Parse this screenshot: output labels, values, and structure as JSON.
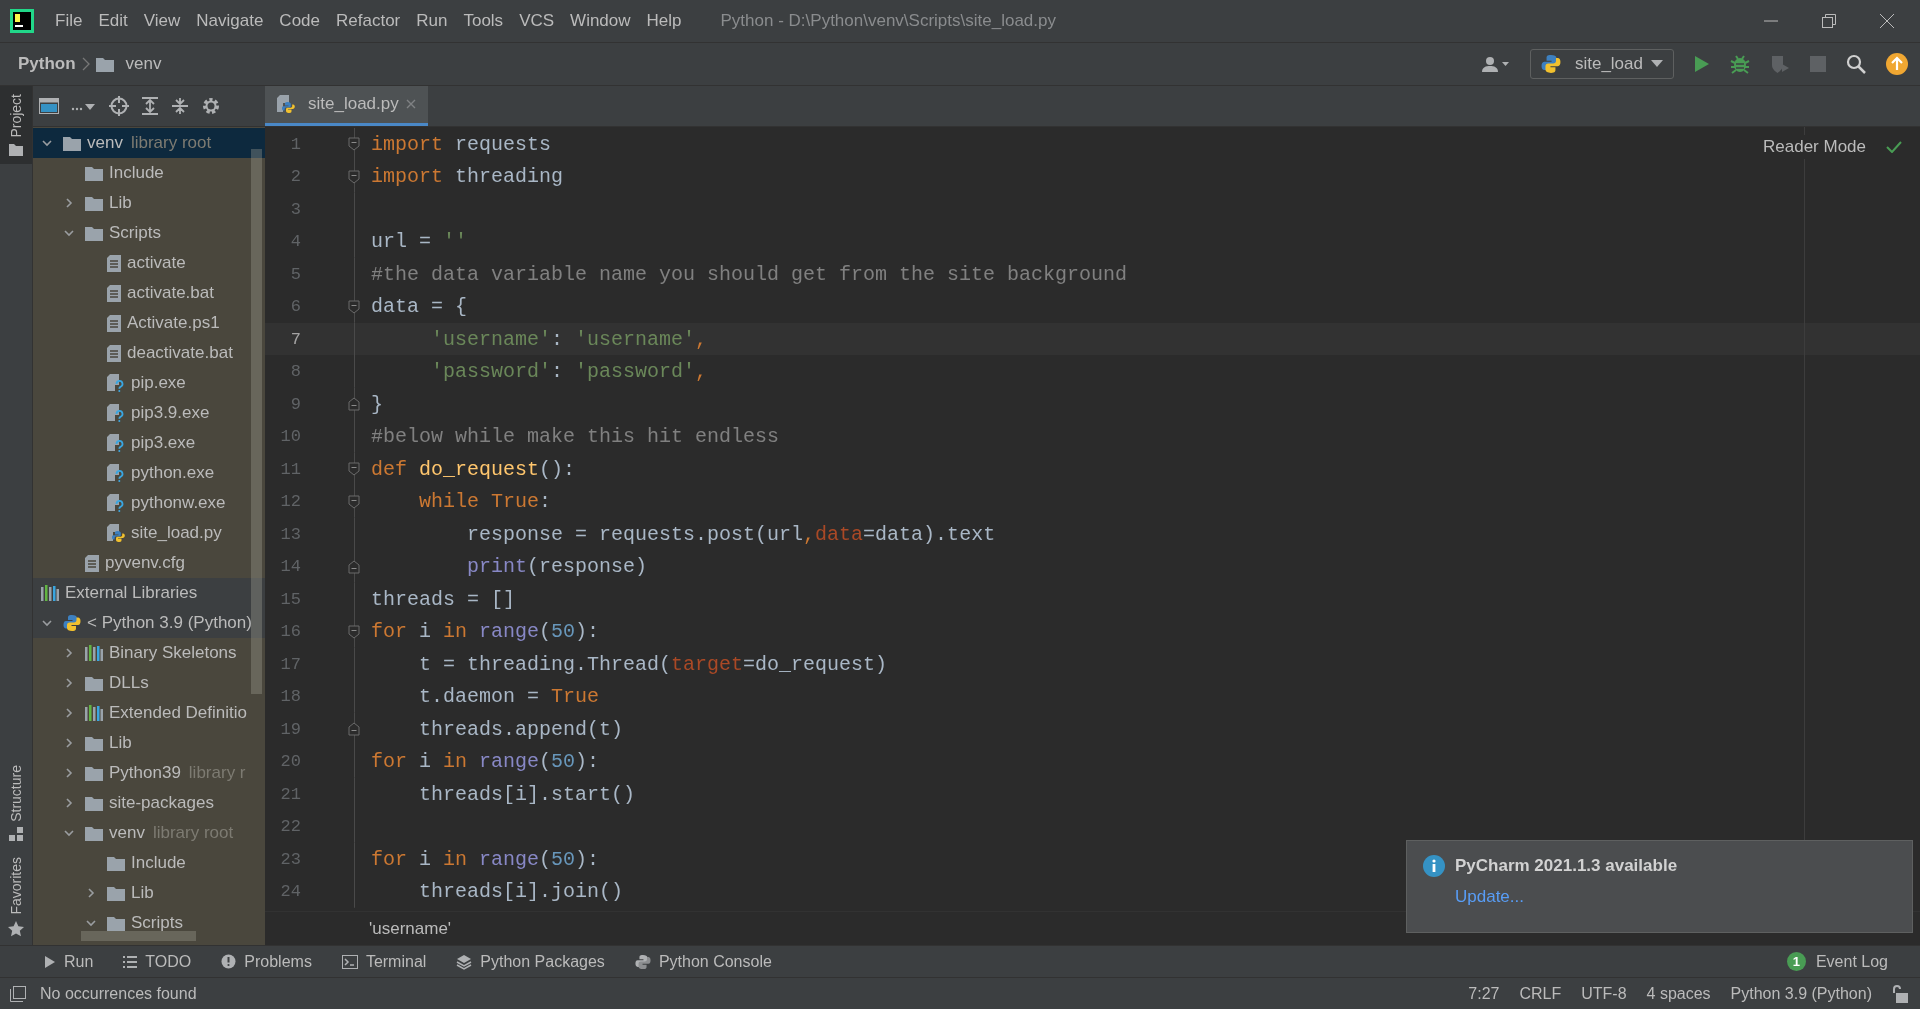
{
  "title_bar": {
    "menu": [
      "File",
      "Edit",
      "View",
      "Navigate",
      "Code",
      "Refactor",
      "Run",
      "Tools",
      "VCS",
      "Window",
      "Help"
    ],
    "title": "Python - D:\\Python\\venv\\Scripts\\site_load.py"
  },
  "navigation_bar": {
    "project": "Python",
    "folder": "venv",
    "run_config": "site_load"
  },
  "side_strip": {
    "top": [
      {
        "label": "Project",
        "kind": "folder",
        "selected": true
      }
    ],
    "bottom": [
      {
        "label": "Structure",
        "kind": "structure",
        "selected": false
      },
      {
        "label": "Favorites",
        "kind": "star",
        "selected": false
      }
    ]
  },
  "project_tree": [
    {
      "label": "venv",
      "suffix": "library root",
      "kind": "folder",
      "expanded": true,
      "selected": true,
      "children": [
        {
          "label": "Include",
          "kind": "folder",
          "selected": false
        },
        {
          "label": "Lib",
          "kind": "folder",
          "expanded": false,
          "selected": false
        },
        {
          "label": "Scripts",
          "kind": "folder",
          "expanded": true,
          "selected": false,
          "children": [
            {
              "label": "activate",
              "kind": "text",
              "selected": false
            },
            {
              "label": "activate.bat",
              "kind": "text",
              "selected": false
            },
            {
              "label": "Activate.ps1",
              "kind": "text",
              "selected": false
            },
            {
              "label": "deactivate.bat",
              "kind": "text",
              "selected": false
            },
            {
              "label": "pip.exe",
              "kind": "unknown",
              "selected": false
            },
            {
              "label": "pip3.9.exe",
              "kind": "unknown",
              "selected": false
            },
            {
              "label": "pip3.exe",
              "kind": "unknown",
              "selected": false
            },
            {
              "label": "python.exe",
              "kind": "unknown",
              "selected": false
            },
            {
              "label": "pythonw.exe",
              "kind": "unknown",
              "selected": false
            },
            {
              "label": "site_load.py",
              "kind": "python",
              "selected": false
            }
          ]
        },
        {
          "label": "pyvenv.cfg",
          "kind": "text",
          "selected": false
        }
      ]
    },
    {
      "label": "External Libraries",
      "kind": "libraries",
      "selected": false,
      "children": [
        {
          "label": "< Python 3.9 (Python)",
          "kind": "sdk",
          "expanded": true,
          "selected": false,
          "children": [
            {
              "label": "Binary Skeletons",
              "kind": "library",
              "expanded": false,
              "selected": false
            },
            {
              "label": "DLLs",
              "kind": "folder",
              "expanded": false,
              "selected": false
            },
            {
              "label": "Extended Definitio",
              "kind": "library",
              "expanded": false,
              "selected": false
            },
            {
              "label": "Lib",
              "kind": "folder",
              "expanded": false,
              "selected": false
            },
            {
              "label": "Python39",
              "suffix": "library r",
              "kind": "folder",
              "expanded": false,
              "selected": false
            },
            {
              "label": "site-packages",
              "kind": "folder",
              "expanded": false,
              "selected": false
            },
            {
              "label": "venv",
              "suffix": "library root",
              "kind": "folder",
              "expanded": true,
              "selected": false,
              "children": [
                {
                  "label": "Include",
                  "kind": "folder",
                  "selected": false
                },
                {
                  "label": "Lib",
                  "kind": "folder",
                  "expanded": false,
                  "selected": false
                },
                {
                  "label": "Scripts",
                  "kind": "folder",
                  "expanded": true,
                  "selected": false
                }
              ]
            }
          ]
        }
      ]
    }
  ],
  "editor_tabs": [
    {
      "label": "site_load.py",
      "selected": true
    }
  ],
  "reader_mode": "Reader Mode",
  "code_lines": [
    {
      "number": "1",
      "kind": "fold-start",
      "current": false,
      "tokens": [
        {
          "kind": "keyword",
          "text": "import"
        },
        {
          "kind": "plain",
          "text": " requests"
        }
      ]
    },
    {
      "number": "2",
      "kind": "fold-start",
      "current": false,
      "tokens": [
        {
          "kind": "keyword",
          "text": "import"
        },
        {
          "kind": "plain",
          "text": " threading"
        }
      ]
    },
    {
      "number": "3",
      "current": false
    },
    {
      "number": "4",
      "current": false,
      "tokens": [
        {
          "kind": "plain",
          "text": "url = "
        },
        {
          "kind": "string",
          "text": "''"
        }
      ]
    },
    {
      "number": "5",
      "current": false,
      "tokens": [
        {
          "kind": "comment",
          "text": "#the data variable name you should get from the site background"
        }
      ]
    },
    {
      "number": "6",
      "kind": "fold-start",
      "current": false,
      "tokens": [
        {
          "kind": "plain",
          "text": "data = {"
        }
      ]
    },
    {
      "number": "7",
      "current": true,
      "tokens": [
        {
          "kind": "string",
          "text": "     'username'"
        },
        {
          "kind": "plain",
          "text": ": "
        },
        {
          "kind": "string",
          "text": "'username'"
        },
        {
          "kind": "keyword",
          "text": ","
        }
      ]
    },
    {
      "number": "8",
      "current": false,
      "tokens": [
        {
          "kind": "string",
          "text": "     'password'"
        },
        {
          "kind": "plain",
          "text": ": "
        },
        {
          "kind": "string",
          "text": "'password'"
        },
        {
          "kind": "keyword",
          "text": ","
        }
      ]
    },
    {
      "number": "9",
      "kind": "fold-end",
      "current": false,
      "tokens": [
        {
          "kind": "plain",
          "text": "}"
        }
      ]
    },
    {
      "number": "10",
      "current": false,
      "tokens": [
        {
          "kind": "comment",
          "text": "#below while make this hit endless"
        }
      ]
    },
    {
      "number": "11",
      "kind": "fold-start",
      "current": false,
      "tokens": [
        {
          "kind": "keyword",
          "text": "def"
        },
        {
          "kind": "function",
          "text": " do_request"
        },
        {
          "kind": "plain",
          "text": "():"
        }
      ]
    },
    {
      "number": "12",
      "kind": "fold-start",
      "current": false,
      "tokens": [
        {
          "kind": "keyword",
          "text": "    while"
        },
        {
          "kind": "keyword",
          "text": " True"
        },
        {
          "kind": "plain",
          "text": ":"
        }
      ]
    },
    {
      "number": "13",
      "current": false,
      "tokens": [
        {
          "kind": "plain",
          "text": "        response = requests.post(url"
        },
        {
          "kind": "keyword",
          "text": ","
        },
        {
          "kind": "parameter",
          "text": "data"
        },
        {
          "kind": "plain",
          "text": "=data).text"
        }
      ]
    },
    {
      "number": "14",
      "kind": "fold-end",
      "current": false,
      "tokens": [
        {
          "kind": "builtin",
          "text": "        print"
        },
        {
          "kind": "plain",
          "text": "(response)"
        }
      ]
    },
    {
      "number": "15",
      "current": false,
      "tokens": [
        {
          "kind": "plain",
          "text": "threads = []"
        }
      ]
    },
    {
      "number": "16",
      "kind": "fold-start",
      "current": false,
      "tokens": [
        {
          "kind": "keyword",
          "text": "for"
        },
        {
          "kind": "plain",
          "text": " i "
        },
        {
          "kind": "keyword",
          "text": "in"
        },
        {
          "kind": "builtin",
          "text": " range"
        },
        {
          "kind": "plain",
          "text": "("
        },
        {
          "kind": "number",
          "text": "50"
        },
        {
          "kind": "plain",
          "text": "):"
        }
      ]
    },
    {
      "number": "17",
      "current": false,
      "tokens": [
        {
          "kind": "plain",
          "text": "    t = threading.Thread("
        },
        {
          "kind": "parameter",
          "text": "target"
        },
        {
          "kind": "plain",
          "text": "=do_request)"
        }
      ]
    },
    {
      "number": "18",
      "current": false,
      "tokens": [
        {
          "kind": "plain",
          "text": "    t.daemon = "
        },
        {
          "kind": "keyword",
          "text": "True"
        }
      ]
    },
    {
      "number": "19",
      "kind": "fold-end",
      "current": false,
      "tokens": [
        {
          "kind": "plain",
          "text": "    threads.append(t)"
        }
      ]
    },
    {
      "number": "20",
      "current": false,
      "tokens": [
        {
          "kind": "keyword",
          "text": "for"
        },
        {
          "kind": "plain",
          "text": " i "
        },
        {
          "kind": "keyword",
          "text": "in"
        },
        {
          "kind": "builtin",
          "text": " range"
        },
        {
          "kind": "plain",
          "text": "("
        },
        {
          "kind": "number",
          "text": "50"
        },
        {
          "kind": "plain",
          "text": "):"
        }
      ]
    },
    {
      "number": "21",
      "current": false,
      "tokens": [
        {
          "kind": "plain",
          "text": "    threads[i].start()"
        }
      ]
    },
    {
      "number": "22",
      "current": false
    },
    {
      "number": "23",
      "current": false,
      "tokens": [
        {
          "kind": "keyword",
          "text": "for"
        },
        {
          "kind": "plain",
          "text": " i "
        },
        {
          "kind": "keyword",
          "text": "in"
        },
        {
          "kind": "builtin",
          "text": " range"
        },
        {
          "kind": "plain",
          "text": "("
        },
        {
          "kind": "number",
          "text": "50"
        },
        {
          "kind": "plain",
          "text": "):"
        }
      ]
    },
    {
      "number": "24",
      "current": false,
      "tokens": [
        {
          "kind": "plain",
          "text": "    threads[i].join()"
        }
      ]
    }
  ],
  "breadcrumb": "'username'",
  "notification": {
    "title": "PyCharm 2021.1.3 available",
    "link": "Update..."
  },
  "tool_windows": [
    {
      "label": "Run",
      "kind": "run"
    },
    {
      "label": "TODO",
      "kind": "list"
    },
    {
      "label": "Problems",
      "kind": "problems"
    },
    {
      "label": "Terminal",
      "kind": "terminal"
    },
    {
      "label": "Python Packages",
      "kind": "layers"
    },
    {
      "label": "Python Console",
      "kind": "python"
    }
  ],
  "event_log": {
    "label": "Event Log",
    "count": "1"
  },
  "status_bar": {
    "message": "No occurrences found",
    "items": [
      "7:27",
      "CRLF",
      "UTF-8",
      "4 spaces",
      "Python 3.9 (Python)"
    ]
  }
}
